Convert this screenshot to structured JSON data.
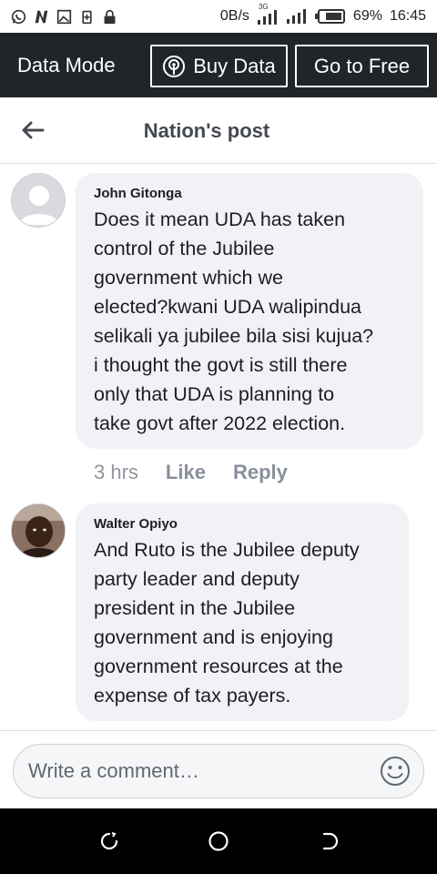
{
  "status_bar": {
    "icons_left": [
      "whatsapp-icon",
      "n-app-icon",
      "image-icon",
      "battery-saver-icon",
      "lock-icon"
    ],
    "network_speed": "0B/s",
    "network_type": "3G",
    "battery": "69%",
    "time": "16:45"
  },
  "data_mode_bar": {
    "title": "Data Mode",
    "buy_label": "Buy Data",
    "free_label": "Go to Free"
  },
  "header": {
    "title": "Nation's post",
    "back_icon": "arrow-left-icon"
  },
  "comments": [
    {
      "author": "John Gitonga",
      "text": "Does it mean UDA has taken\ncontrol of the Jubilee\ngovernment which we\nelected?kwani UDA walipindua\nselikali ya jubilee bila sisi kujua?\ni thought the govt is still there\nonly that UDA is planning to\ntake govt after 2022 election.",
      "time": "3 hrs",
      "like_label": "Like",
      "reply_label": "Reply"
    },
    {
      "author": "Walter Opiyo",
      "text": "And Ruto is the Jubilee deputy\nparty leader and deputy\npresident in the Jubilee\ngovernment and is enjoying\ngovernment resources at the\nexpense of tax payers."
    }
  ],
  "composer": {
    "placeholder": "Write a comment…"
  },
  "colors": {
    "data_bar_bg": "#212529",
    "bubble_bg": "#f0f2f5",
    "nav_bg": "#000000"
  }
}
